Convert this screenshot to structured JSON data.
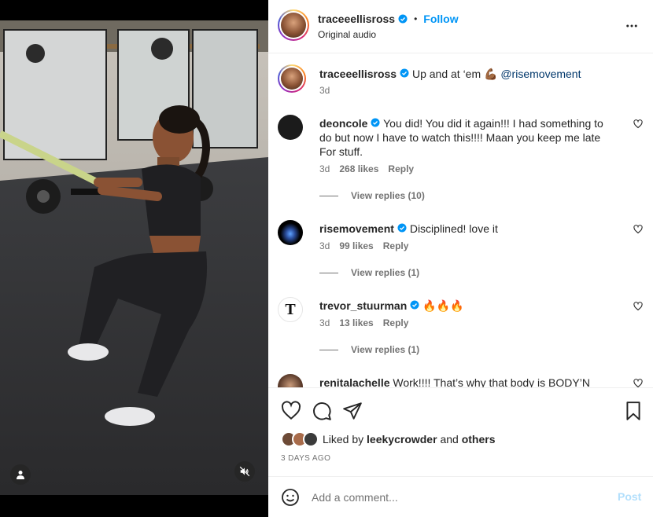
{
  "media": {
    "user_tag_icon": "person-icon",
    "mute_icon": "speaker-muted-icon"
  },
  "header": {
    "username": "traceeellisross",
    "separator": "•",
    "follow_label": "Follow",
    "audio_label": "Original audio",
    "more_icon": "more-horizontal-icon"
  },
  "caption": {
    "username": "traceeellisross",
    "text": "Up and at ‘em 💪🏾",
    "mention": "@risemovement",
    "time": "3d"
  },
  "comments": [
    {
      "username": "deoncole",
      "text": "You did! You did it again!!! I had something to do but now I have to watch this!!!! Maan you keep me late For stuff.",
      "time": "3d",
      "likes": "268 likes",
      "reply_label": "Reply",
      "view_replies": "View replies (10)"
    },
    {
      "username": "risemovement",
      "text": "Disciplined! love it",
      "time": "3d",
      "likes": "99 likes",
      "reply_label": "Reply",
      "view_replies": "View replies (1)"
    },
    {
      "username": "trevor_stuurman",
      "text": "🔥🔥🔥",
      "time": "3d",
      "likes": "13 likes",
      "reply_label": "Reply",
      "view_replies": "View replies (1)"
    },
    {
      "username": "renitalachelle",
      "text": "Work!!!! That’s why that body is BODY’N"
    }
  ],
  "actions": {
    "like_icon": "heart-icon",
    "comment_icon": "comment-bubble-icon",
    "share_icon": "paper-plane-icon",
    "save_icon": "bookmark-icon",
    "liked_prefix": "Liked by",
    "liked_user": "leekycrowder",
    "liked_and": "and",
    "liked_others": "others",
    "date": "3 DAYS AGO"
  },
  "add_comment": {
    "emoji_icon": "smiley-icon",
    "placeholder": "Add a comment...",
    "post_label": "Post"
  },
  "colors": {
    "link_blue": "#0095f6",
    "mention_blue": "#00376b",
    "post_disabled": "#b2dffc",
    "secondary_text": "#737373"
  }
}
